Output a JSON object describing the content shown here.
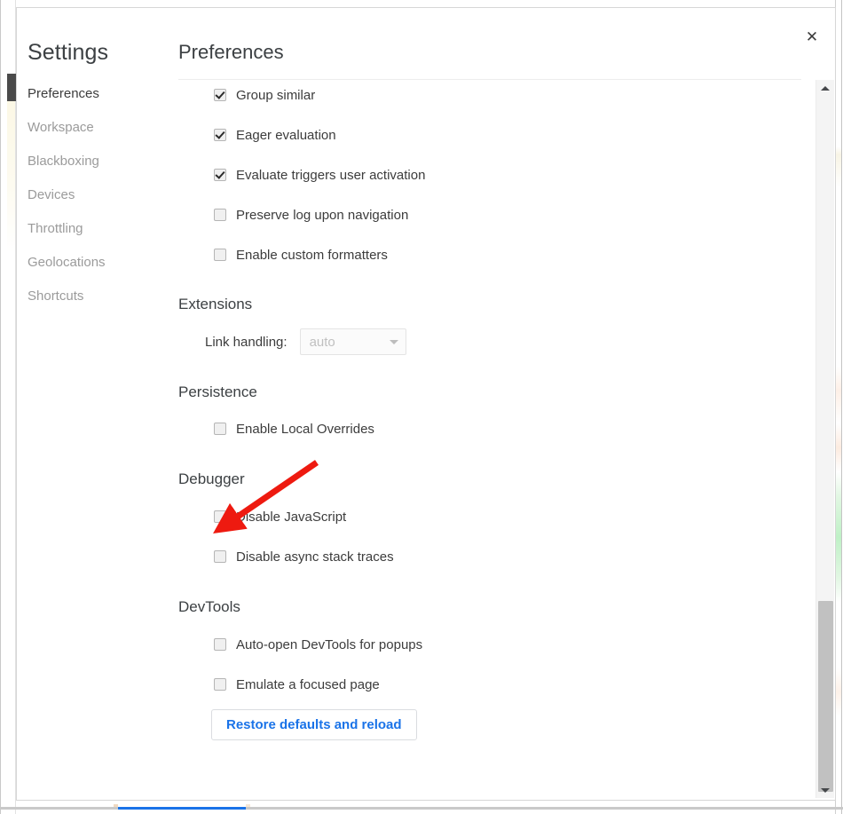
{
  "dialog": {
    "title": "Settings",
    "close_icon": "close-icon"
  },
  "sidebar": {
    "items": [
      {
        "label": "Preferences",
        "active": true
      },
      {
        "label": "Workspace",
        "active": false
      },
      {
        "label": "Blackboxing",
        "active": false
      },
      {
        "label": "Devices",
        "active": false
      },
      {
        "label": "Throttling",
        "active": false
      },
      {
        "label": "Geolocations",
        "active": false
      },
      {
        "label": "Shortcuts",
        "active": false
      }
    ]
  },
  "content": {
    "title": "Preferences",
    "console_options": [
      {
        "label": "Group similar",
        "checked": true
      },
      {
        "label": "Eager evaluation",
        "checked": true
      },
      {
        "label": "Evaluate triggers user activation",
        "checked": true
      },
      {
        "label": "Preserve log upon navigation",
        "checked": false
      },
      {
        "label": "Enable custom formatters",
        "checked": false
      }
    ],
    "extensions": {
      "heading": "Extensions",
      "link_handling_label": "Link handling:",
      "link_handling_value": "auto",
      "dropdown_icon": "chevron-down-icon"
    },
    "persistence": {
      "heading": "Persistence",
      "options": [
        {
          "label": "Enable Local Overrides",
          "checked": false
        }
      ]
    },
    "debugger": {
      "heading": "Debugger",
      "options": [
        {
          "label": "Disable JavaScript",
          "checked": false
        },
        {
          "label": "Disable async stack traces",
          "checked": false
        }
      ]
    },
    "devtools": {
      "heading": "DevTools",
      "options": [
        {
          "label": "Auto-open DevTools for popups",
          "checked": false
        },
        {
          "label": "Emulate a focused page",
          "checked": false
        }
      ]
    },
    "restore_button_label": "Restore defaults and reload"
  },
  "scrollbar": {
    "up_icon": "triangle-up-icon",
    "down_icon": "triangle-down-icon"
  },
  "annotation": {
    "name": "red-arrow-annotation",
    "color": "#ee1a10",
    "points_to": "Disable JavaScript"
  },
  "colors": {
    "accent_blue": "#1a73e8",
    "text_primary": "#3c3c3c",
    "text_muted": "#9b9b9b",
    "annotation_red": "#ee1a10"
  }
}
